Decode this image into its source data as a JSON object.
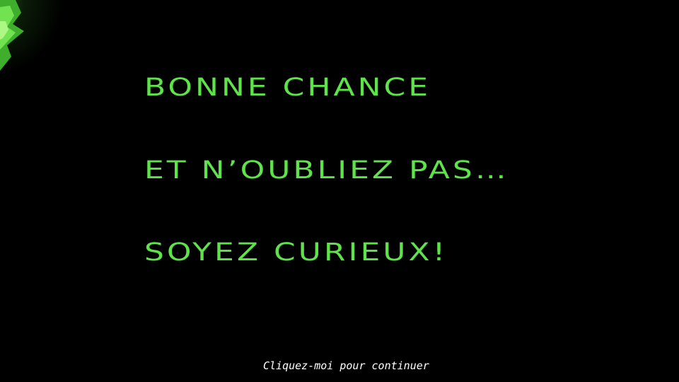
{
  "slide": {
    "lines": [
      "BONNE CHANCE",
      "ET N’OUBLIEZ PAS…",
      "SOYEZ CURIEUX!"
    ],
    "continue_label": "Cliquez-moi pour continuer"
  },
  "colors": {
    "background": "#000000",
    "text_accent": "#5fe34a",
    "link_text": "#ffffff"
  },
  "icons": {
    "corner": "green-spiky-corner-icon"
  }
}
